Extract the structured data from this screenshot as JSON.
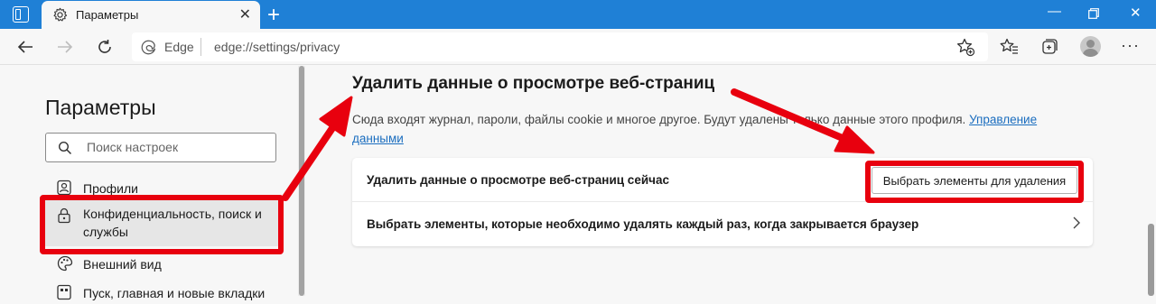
{
  "browser": {
    "tab_title": "Параметры",
    "address_label": "Edge",
    "address_url": "edge://settings/privacy"
  },
  "sidebar": {
    "title": "Параметры",
    "search_placeholder": "Поиск настроек",
    "items": [
      {
        "label": "Профили",
        "icon": "profile-icon"
      },
      {
        "label": "Конфиденциальность, поиск и службы",
        "icon": "lock-icon",
        "active": true
      },
      {
        "label": "Внешний вид",
        "icon": "appearance-icon"
      },
      {
        "label": "Пуск, главная и новые вкладки",
        "icon": "home-tabs-icon"
      }
    ]
  },
  "main": {
    "section_title": "Удалить данные о просмотре веб-страниц",
    "section_desc": "Сюда входят журнал, пароли, файлы cookie и многое другое. Будут удалены только данные этого профиля.",
    "manage_link": "Управление данными",
    "row1_label": "Удалить данные о просмотре веб-страниц сейчас",
    "row1_button": "Выбрать элементы для удаления",
    "row2_label": "Выбрать элементы, которые необходимо удалять каждый раз, когда закрывается браузер"
  },
  "colors": {
    "titlebar": "#1f80d6",
    "highlight": "#e8000e",
    "link": "#1a6dbf"
  }
}
